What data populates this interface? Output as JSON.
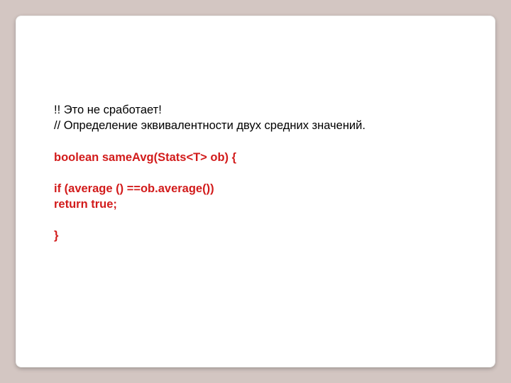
{
  "slide": {
    "lines": {
      "l1": "!! Это не сработает!",
      "l2": "// Определение эквивалентности двух средних значений.",
      "l3": "boolean sameAvg(Stats<T> ob) {",
      "l4": "if (average () ==ob.average())",
      "l5": "return true;",
      "l6": "}"
    }
  }
}
